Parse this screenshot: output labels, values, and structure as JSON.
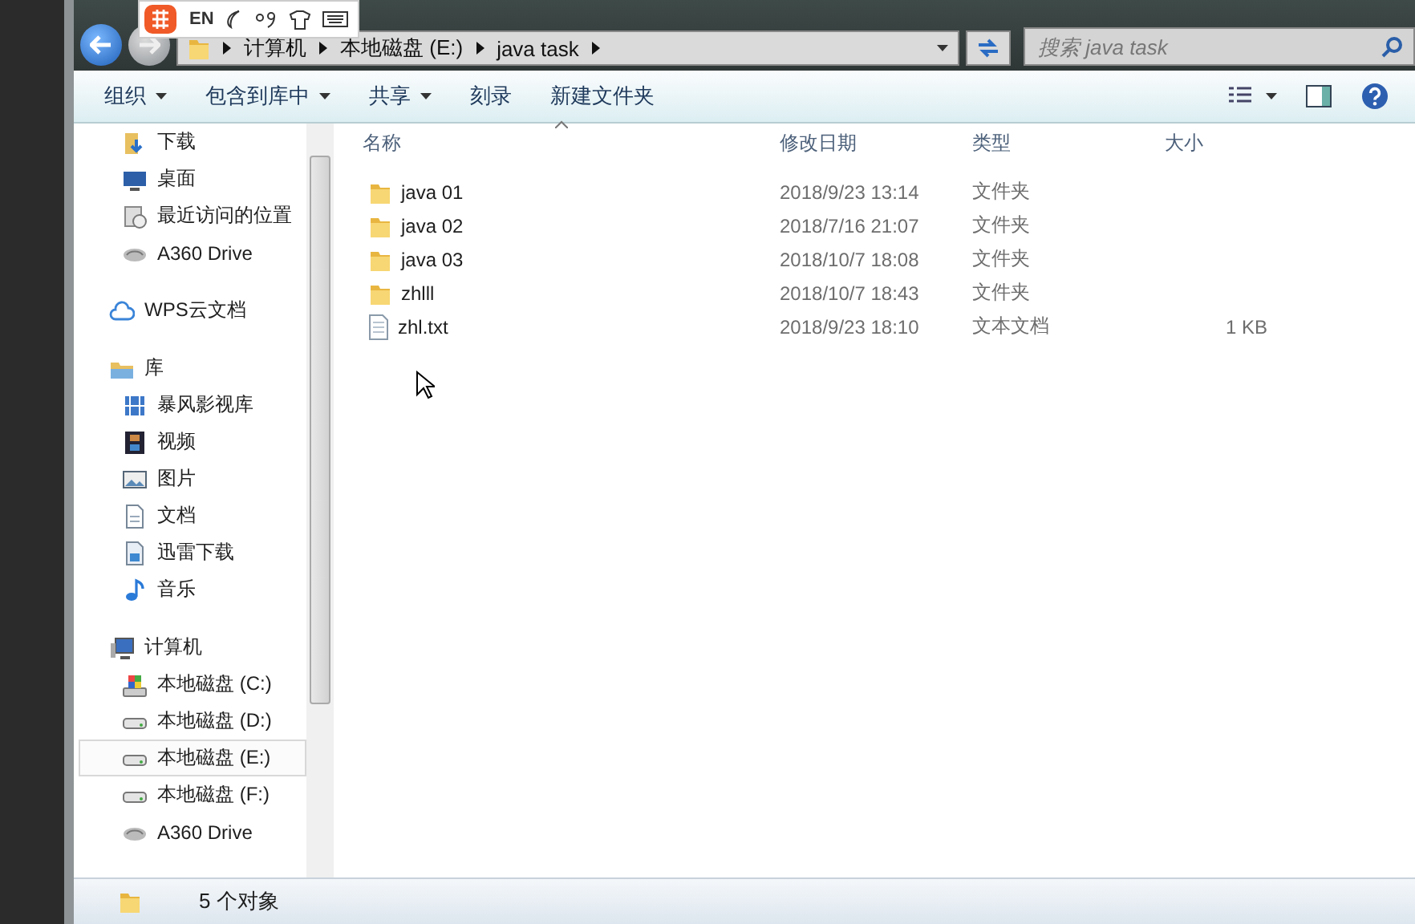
{
  "ime_bar": {
    "language": "EN"
  },
  "address_bar": {
    "crumbs": [
      "计算机",
      "本地磁盘 (E:)",
      "java task"
    ]
  },
  "search": {
    "placeholder": "搜索 java task"
  },
  "toolbar": {
    "buttons": [
      {
        "label": "组织",
        "has_menu": true
      },
      {
        "label": "包含到库中",
        "has_menu": true
      },
      {
        "label": "共享",
        "has_menu": true
      },
      {
        "label": "刻录",
        "has_menu": false
      },
      {
        "label": "新建文件夹",
        "has_menu": false
      }
    ]
  },
  "sidebar": {
    "groups": [
      {
        "children": [
          {
            "label": "下载",
            "kind": "download",
            "selected": false
          },
          {
            "label": "桌面",
            "kind": "desktop",
            "selected": false
          },
          {
            "label": "最近访问的位置",
            "kind": "recent",
            "selected": false
          },
          {
            "label": "A360 Drive",
            "kind": "cloud",
            "selected": false
          }
        ]
      },
      {
        "label": "WPS云文档",
        "kind": "wps",
        "selected": false
      },
      {
        "label": "库",
        "kind": "library",
        "selected": false,
        "children": [
          {
            "label": "暴风影视库",
            "kind": "media",
            "selected": false
          },
          {
            "label": "视频",
            "kind": "video",
            "selected": false
          },
          {
            "label": "图片",
            "kind": "picture",
            "selected": false
          },
          {
            "label": "文档",
            "kind": "document",
            "selected": false
          },
          {
            "label": "迅雷下载",
            "kind": "download2",
            "selected": false
          },
          {
            "label": "音乐",
            "kind": "music",
            "selected": false
          }
        ]
      },
      {
        "label": "计算机",
        "kind": "computer",
        "selected": false,
        "children": [
          {
            "label": "本地磁盘 (C:)",
            "kind": "sysdrive",
            "selected": false
          },
          {
            "label": "本地磁盘 (D:)",
            "kind": "drive",
            "selected": false
          },
          {
            "label": "本地磁盘 (E:)",
            "kind": "drive",
            "selected": true
          },
          {
            "label": "本地磁盘 (F:)",
            "kind": "drive",
            "selected": false
          },
          {
            "label": "A360 Drive",
            "kind": "cloud",
            "selected": false
          }
        ]
      }
    ]
  },
  "table": {
    "columns": [
      "名称",
      "修改日期",
      "类型",
      "大小"
    ],
    "rows": [
      {
        "kind": "folder",
        "name": "java 01",
        "modified": "2018/9/23 13:14",
        "type": "文件夹",
        "size": null
      },
      {
        "kind": "folder",
        "name": "java 02",
        "modified": "2018/7/16 21:07",
        "type": "文件夹",
        "size": null
      },
      {
        "kind": "folder",
        "name": "java 03",
        "modified": "2018/10/7 18:08",
        "type": "文件夹",
        "size": null
      },
      {
        "kind": "folder",
        "name": "zhlll",
        "modified": "2018/10/7 18:43",
        "type": "文件夹",
        "size": null
      },
      {
        "kind": "file",
        "name": "zhl.txt",
        "modified": "2018/9/23 18:10",
        "type": "文本文档",
        "size": "1 KB"
      }
    ]
  },
  "status_bar": {
    "count": "5 个对象"
  }
}
